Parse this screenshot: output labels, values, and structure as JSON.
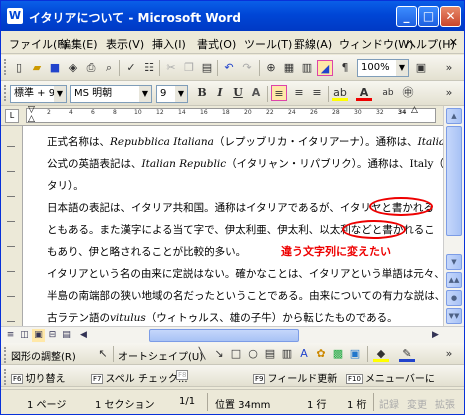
{
  "window": {
    "title": "イタリアについて - Microsoft Word",
    "app_icon": "W"
  },
  "menu": [
    "ファイル(F)",
    "編集(E)",
    "表示(V)",
    "挿入(I)",
    "書式(O)",
    "ツール(T)",
    "罫線(A)",
    "ウィンドウ(W)",
    "ヘルプ(H)"
  ],
  "standard_toolbar": {
    "zoom": "100%"
  },
  "format_toolbar": {
    "style": "標準 + 9 |",
    "font": "MS 明朝",
    "size": "9",
    "bold": "B",
    "italic": "I",
    "underline": "U"
  },
  "ruler": {
    "numbers": [
      "2",
      "4",
      "6",
      "8",
      "10",
      "12",
      "14",
      "16",
      "18",
      "20",
      "22",
      "24",
      "26",
      "28",
      "30",
      "32",
      "34"
    ]
  },
  "document": {
    "l1a": "正式名称は、",
    "l1b": "Repubblica Italiana",
    "l1c": "（レプッブリカ・イタリアーナ）。通称は、",
    "l1d": "Italia",
    "l2a": "公式の英語表記は、",
    "l2b": "Italian Republic",
    "l2c": "（イタリャン・リパブリク）。通称は、Italy（イ",
    "l3": "タリ）。",
    "l4": "日本語の表記は、イタリア共和国。通称はイタリアであるが、イタリヤと書かれる",
    "l5": "ともある。また漢字による当て字で、伊太利亜、伊太利、以太利などと書かれるこ",
    "l6": "もあり、伊と略されることが比較的多い。",
    "l7": "イタリアという名の由来に定説はない。確かなことは、イタリアという単語は元々、",
    "l8": "半島の南端部の狭い地域の名だったということである。由来についての有力な説は、",
    "l9a": "古ラテン語の",
    "l9b": "vitulus",
    "l9c": "（ウィトゥルス、雄の子牛）から転じたものである。"
  },
  "annotation": "違う文字列に変えたい",
  "drawing_toolbar": {
    "adjust": "図形の調整(R)",
    "autoshape": "オートシェイプ(U)"
  },
  "function_keys": [
    {
      "key": "F6",
      "label": "切り替え",
      "enabled": true
    },
    {
      "key": "F7",
      "label": "スペル チェック...",
      "enabled": true
    },
    {
      "key": "F8",
      "label": "",
      "enabled": false
    },
    {
      "key": "F9",
      "label": "フィールド更新",
      "enabled": true
    },
    {
      "key": "F10",
      "label": "メニューバーに",
      "enabled": true
    }
  ],
  "status": {
    "page": "1 ページ",
    "section": "1 セクション",
    "pages": "1/1",
    "position": "位置 34mm",
    "row": "1 行",
    "col": "1 桁",
    "rec": "記録",
    "trk": "変更",
    "ext": "拡張"
  }
}
